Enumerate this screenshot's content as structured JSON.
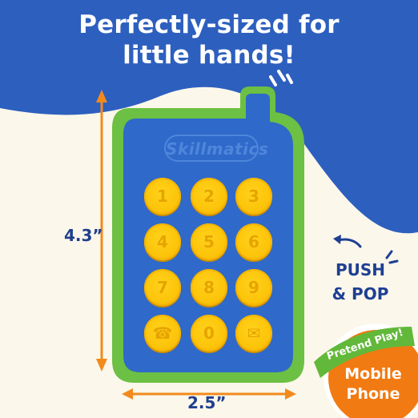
{
  "headline": {
    "line1": "Perfectly-sized for",
    "line2": "little hands!"
  },
  "phone": {
    "brand_logo": "Skillmatics",
    "keys": [
      "1",
      "2",
      "3",
      "4",
      "5",
      "6",
      "7",
      "8",
      "9",
      "☎",
      "0",
      "✉"
    ]
  },
  "dimensions": {
    "height": "4.3”",
    "width": "2.5”"
  },
  "callout": {
    "line1": "PUSH",
    "line2": "& POP"
  },
  "badge": {
    "ribbon": "Pretend Play!",
    "line1": "Mobile",
    "line2": "Phone"
  },
  "colors": {
    "blue_background": "#2d5fbe",
    "cream_background": "#fbf7ea",
    "phone_body": "#2f69c9",
    "phone_border": "#6cc043",
    "keys": "#fcc40a",
    "arrow": "#f28a1c",
    "badge_orange": "#f27a12",
    "badge_green": "#62b83a"
  }
}
